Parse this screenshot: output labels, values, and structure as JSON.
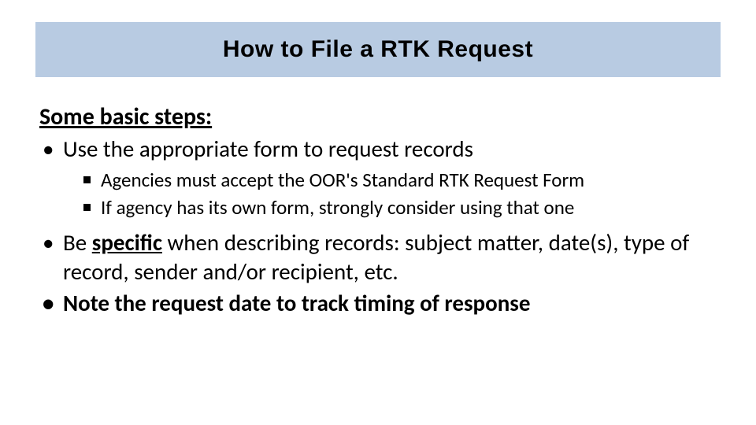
{
  "title": "How to File a RTK Request",
  "heading": "Some basic steps:",
  "bullets": {
    "b1": "Use the appropriate form to request records",
    "b1_sub1": "Agencies must accept the OOR's Standard RTK Request Form",
    "b1_sub2": "If agency has its own form, strongly consider using that one",
    "b2_pre": "Be ",
    "b2_bold": "specific",
    "b2_post": " when describing records: subject matter, date(s), type of record, sender and/or recipient, etc.",
    "b3": "Note the request date to track timing of response"
  }
}
